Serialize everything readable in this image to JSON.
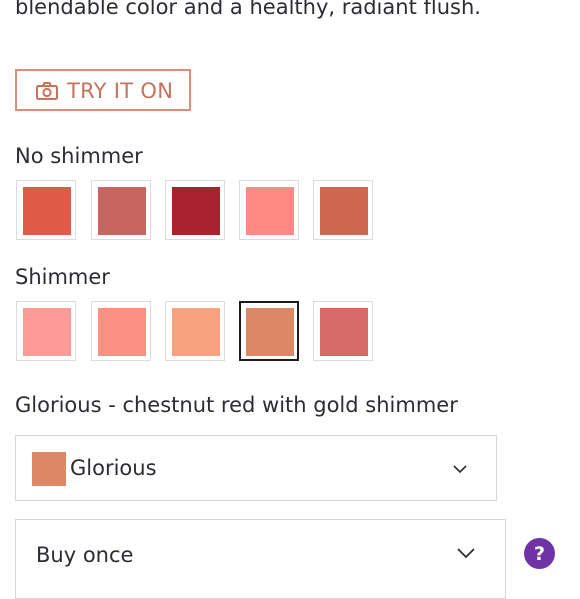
{
  "description_tail": "blendable color and a healthy, radiant flush.",
  "try_on": {
    "label": "TRY IT ON",
    "icon": "camera-icon"
  },
  "groups": {
    "no_shimmer": {
      "label": "No shimmer",
      "swatches": [
        {
          "name": "",
          "color": "#df5a47"
        },
        {
          "name": "",
          "color": "#c96560"
        },
        {
          "name": "",
          "color": "#a8232f"
        },
        {
          "name": "",
          "color": "#fd8a84"
        },
        {
          "name": "",
          "color": "#cf6650"
        }
      ]
    },
    "shimmer": {
      "label": "Shimmer",
      "swatches": [
        {
          "name": "",
          "color": "#fd9a98"
        },
        {
          "name": "",
          "color": "#fc9082"
        },
        {
          "name": "",
          "color": "#f7a27e"
        },
        {
          "name": "Glorious",
          "color": "#dd8767",
          "selected": true
        },
        {
          "name": "",
          "color": "#d56b66"
        }
      ]
    }
  },
  "selected_shade": {
    "heading": "Glorious - chestnut red with gold shimmer",
    "dropdown_value": "Glorious",
    "color": "#dd8767"
  },
  "purchase_option": {
    "value": "Buy once"
  },
  "help": {
    "label": "?"
  }
}
